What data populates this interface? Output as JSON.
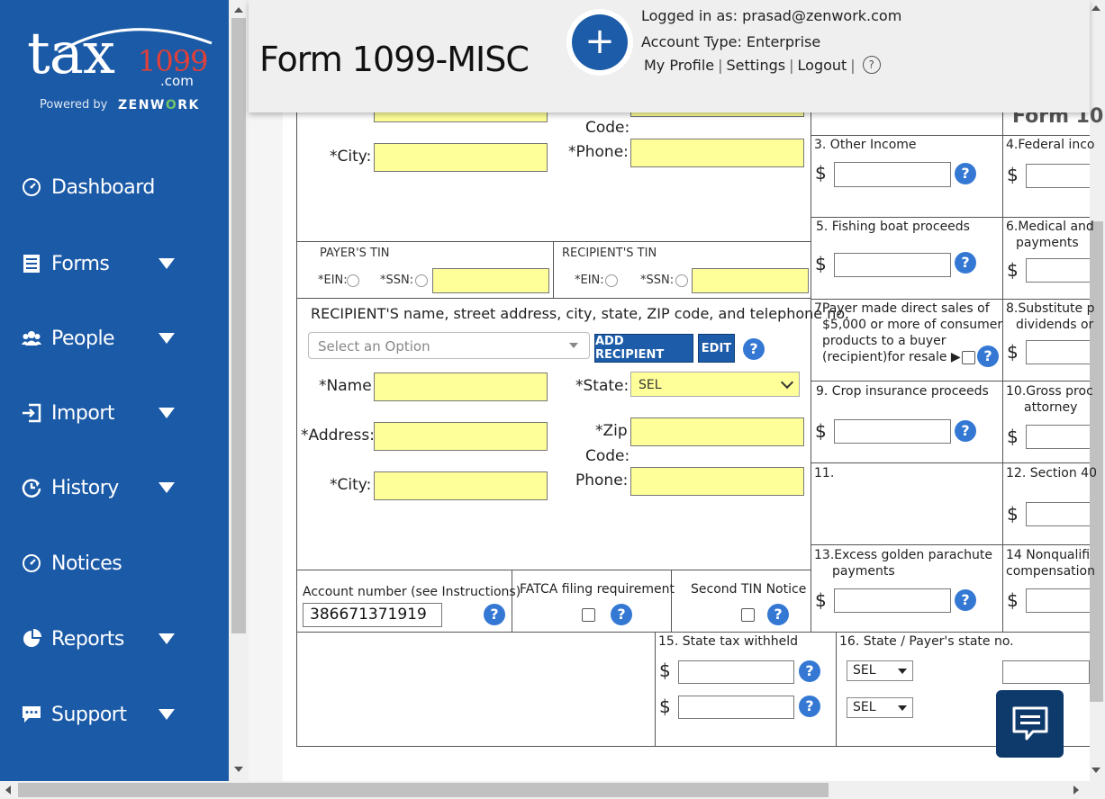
{
  "logo": {
    "tax": "tax",
    "number": "1099",
    "com": ".com",
    "powered_by": "Powered by",
    "brand": "ZENW",
    "brand_o": "O",
    "brand_end": "RK"
  },
  "sidebar": {
    "items": [
      {
        "label": "Dashboard",
        "icon": "dashboard-icon",
        "has_caret": false
      },
      {
        "label": "Forms",
        "icon": "forms-icon",
        "has_caret": true
      },
      {
        "label": "People",
        "icon": "people-icon",
        "has_caret": true
      },
      {
        "label": "Import",
        "icon": "import-icon",
        "has_caret": true
      },
      {
        "label": "History",
        "icon": "history-icon",
        "has_caret": true
      },
      {
        "label": "Notices",
        "icon": "notices-icon",
        "has_caret": false
      },
      {
        "label": "Reports",
        "icon": "reports-icon",
        "has_caret": true
      },
      {
        "label": "Support",
        "icon": "support-icon",
        "has_caret": true
      }
    ]
  },
  "header": {
    "title": "Form 1099-MISC",
    "add_symbol": "+",
    "logged_in_label": "Logged in as: prasad@zenwork.com",
    "account_type": "Account Type: Enterprise",
    "my_profile": "My Profile",
    "settings": "Settings",
    "logout": "Logout",
    "separator": "|",
    "help_symbol": "?"
  },
  "payer": {
    "code_label": "Code:",
    "city_label": "*City:",
    "phone_label": "*Phone:"
  },
  "tin": {
    "payer_tin_label": "PAYER'S TIN",
    "recipient_tin_label": "RECIPIENT'S TIN",
    "ein_label": "*EIN:",
    "ssn_label": "*SSN:"
  },
  "recipient": {
    "section_label": "RECIPIENT'S name, street address, city, state, ZIP code, and telephone no.",
    "select_placeholder": "Select an Option",
    "add_button": "ADD RECIPIENT",
    "edit_button": "EDIT",
    "name_label": "*Name",
    "address_label": "*Address:",
    "city_label": "*City:",
    "state_label": "*State:",
    "state_value": "SEL",
    "zip_label_1": "*Zip",
    "zip_label_2": "Code:",
    "phone_label": "Phone:"
  },
  "account": {
    "account_label": "Account number (see Instructions)",
    "account_value": "386671371919",
    "fatca_label": "FATCA filing requirement",
    "second_tin_label": "Second TIN Notice"
  },
  "state_tax": {
    "withheld_label": "15. State tax withheld",
    "payer_state_label": "16. State / Payer's state no.",
    "sel_1": "SEL",
    "sel_2": "SEL"
  },
  "boxes": {
    "form_label": "Form 10",
    "box3": "3. Other Income",
    "box4": "4.Federal inco",
    "box5": "5. Fishing boat proceeds",
    "box6_1": "6.Medical and",
    "box6_2": "payments",
    "box7_1": "7Payer made direct sales of",
    "box7_2": "$5,000 or more of consumer",
    "box7_3": "products to a buyer",
    "box7_4": "(recipient)for resale ▶",
    "box8_1": "8.Substitute p",
    "box8_2": "dividends or",
    "box9": "9. Crop insurance proceeds",
    "box10_1": "10.Gross proc",
    "box10_2": "attorney",
    "box11": "11.",
    "box12": "12. Section 40",
    "box13_1": "13.Excess golden parachute",
    "box13_2": "payments",
    "box14_1": "14 Nonqualifi",
    "box14_2": "compensation",
    "dollar": "$"
  },
  "colors": {
    "sidebar_bg": "#1b5aa7",
    "field_yellow": "#ffff99",
    "button_blue": "#1d5ca8",
    "help_blue": "#3478d4",
    "logo_red": "#e04038"
  }
}
